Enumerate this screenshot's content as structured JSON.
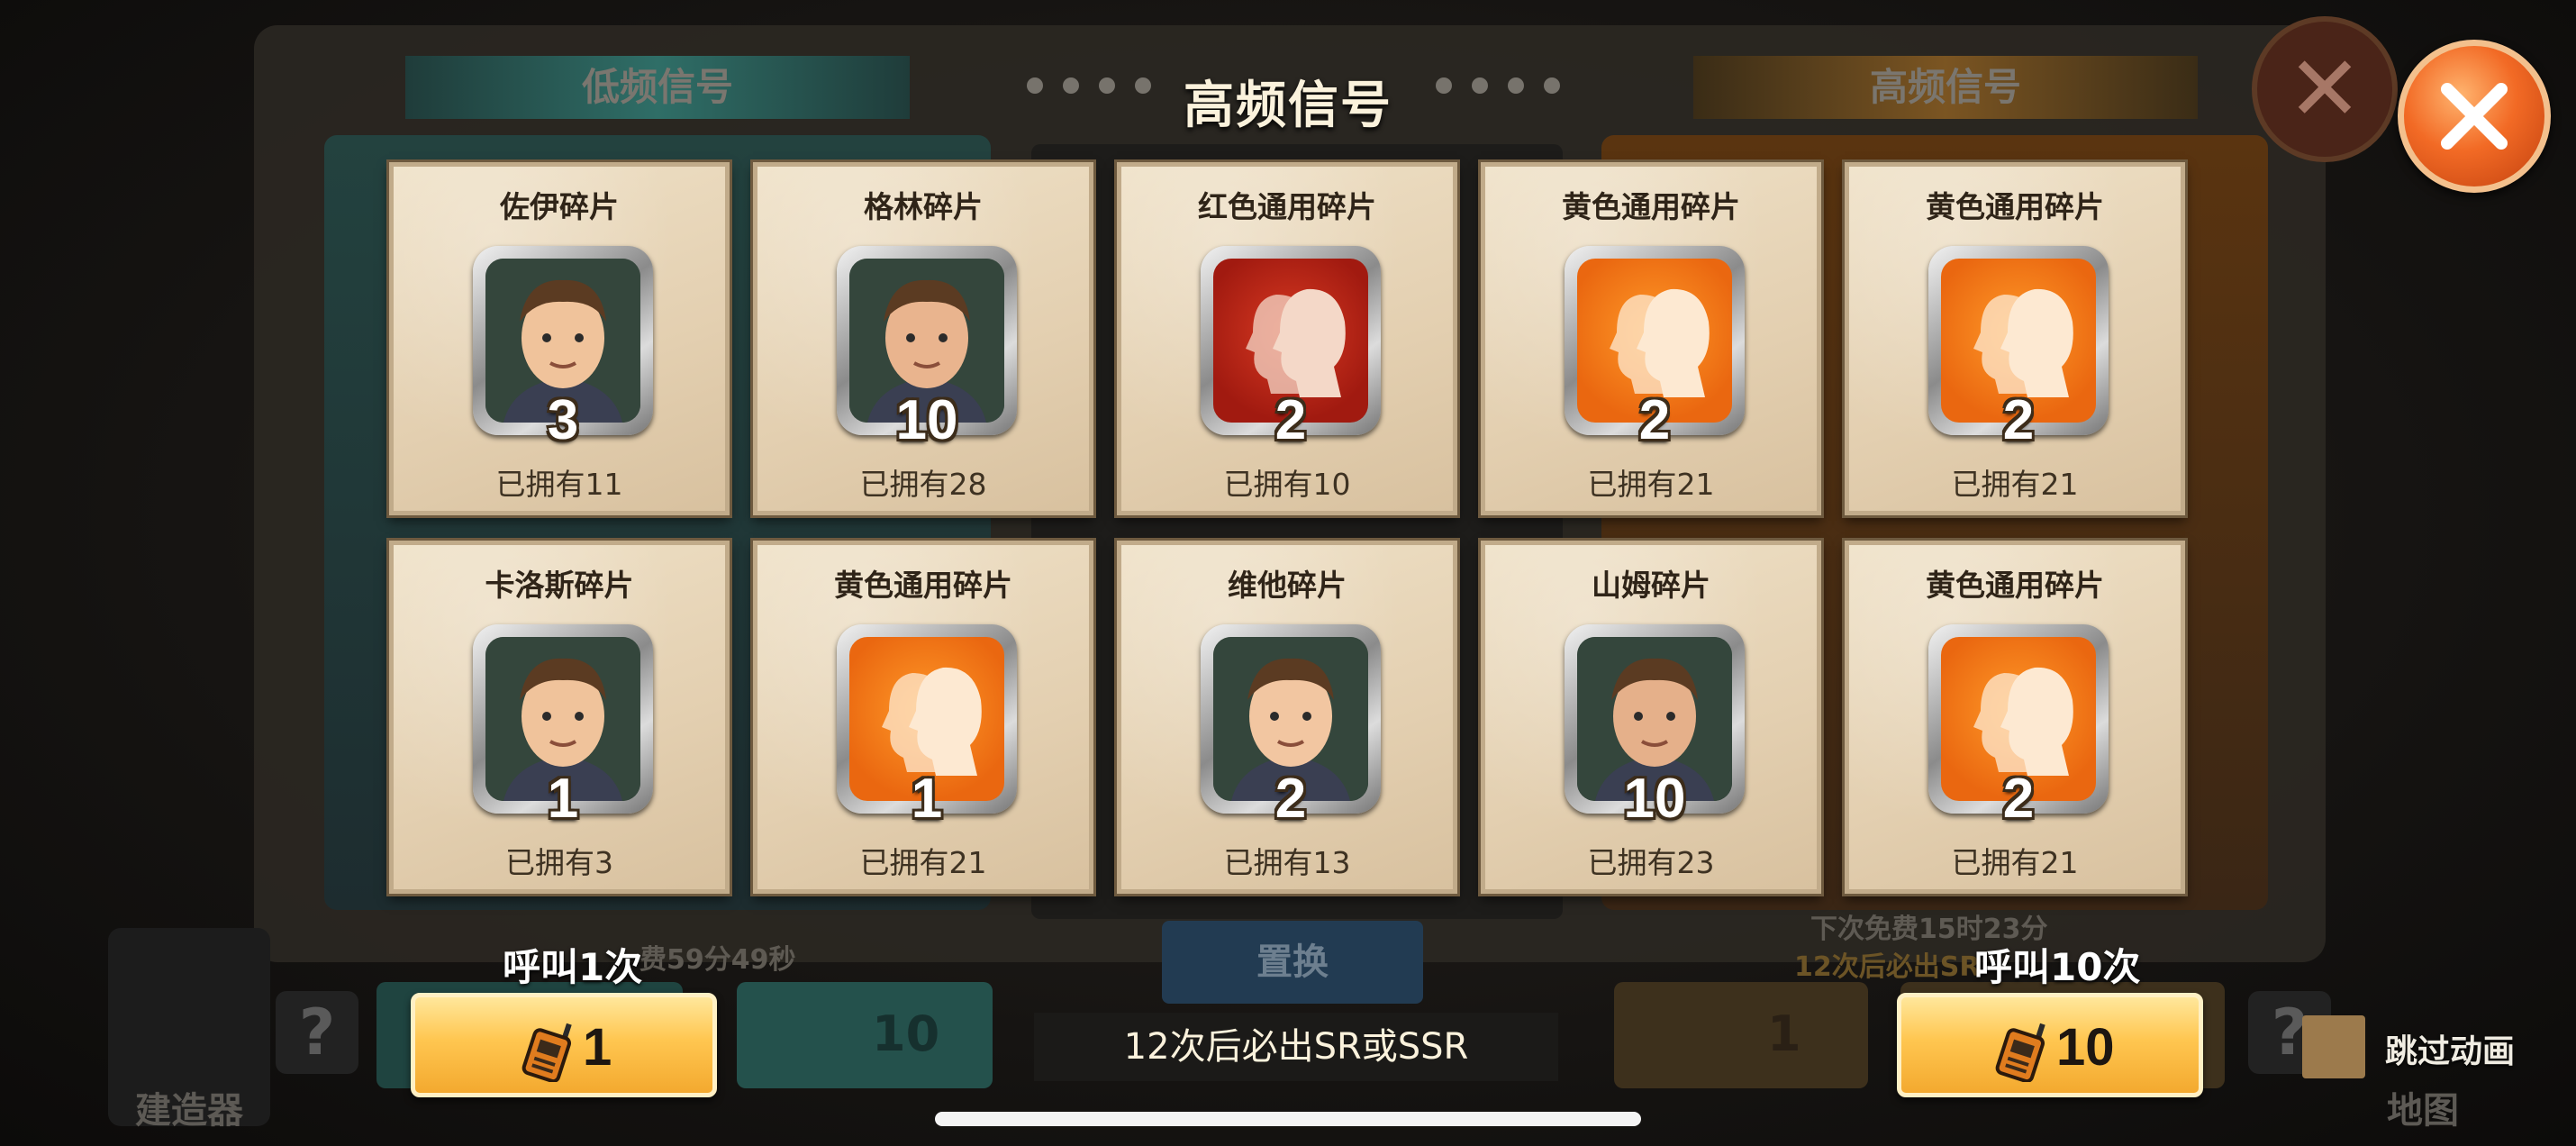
{
  "background": {
    "tab_left": "低频信号",
    "tab_right": "高频信号",
    "swap_label": "置换",
    "free_timer_left": "费59分49秒",
    "free_timer_right": "下次免费15时23分",
    "guarantee_right": "12次后必出SR",
    "builder_label": "建造器",
    "map_label": "地图",
    "btn_left_single": "1",
    "btn_left_ten": "10",
    "btn_right_single": "1",
    "help_glyph": "?"
  },
  "dialog": {
    "title": "高频信号",
    "cards": [
      {
        "name": "佐伊碎片",
        "qty": "3",
        "owned": "已拥有11",
        "icon": "zoe-portrait-icon",
        "kind": "hero"
      },
      {
        "name": "格林碎片",
        "qty": "10",
        "owned": "已拥有28",
        "icon": "green-portrait-icon",
        "kind": "hero"
      },
      {
        "name": "红色通用碎片",
        "qty": "2",
        "owned": "已拥有10",
        "icon": "red-universal-shard-icon",
        "kind": "red"
      },
      {
        "name": "黄色通用碎片",
        "qty": "2",
        "owned": "已拥有21",
        "icon": "yellow-universal-shard-icon",
        "kind": "orange"
      },
      {
        "name": "黄色通用碎片",
        "qty": "2",
        "owned": "已拥有21",
        "icon": "yellow-universal-shard-icon",
        "kind": "orange"
      },
      {
        "name": "卡洛斯碎片",
        "qty": "1",
        "owned": "已拥有3",
        "icon": "carlos-portrait-icon",
        "kind": "hero"
      },
      {
        "name": "黄色通用碎片",
        "qty": "1",
        "owned": "已拥有21",
        "icon": "yellow-universal-shard-icon",
        "kind": "orange"
      },
      {
        "name": "维他碎片",
        "qty": "2",
        "owned": "已拥有13",
        "icon": "vita-portrait-icon",
        "kind": "hero"
      },
      {
        "name": "山姆碎片",
        "qty": "10",
        "owned": "已拥有23",
        "icon": "sam-portrait-icon",
        "kind": "hero"
      },
      {
        "name": "黄色通用碎片",
        "qty": "2",
        "owned": "已拥有21",
        "icon": "yellow-universal-shard-icon",
        "kind": "orange"
      }
    ],
    "call_once_label": "呼叫1次",
    "call_once_count": "1",
    "call_ten_label": "呼叫10次",
    "call_ten_count": "10",
    "guarantee": "12次后必出SR或SSR",
    "skip_animation": "跳过动画"
  },
  "colors": {
    "accent_orange": "#f26a25",
    "button_gold": "#ffc650",
    "card_parchment": "#e3cfb0"
  }
}
